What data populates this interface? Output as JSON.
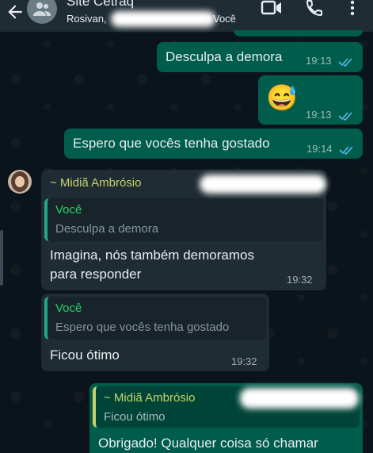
{
  "header": {
    "title": "Site Cetraq",
    "subtitle": "Rosivan,",
    "subtitle_end": "Você"
  },
  "messages": {
    "m1": {
      "text": "Desculpa a demora",
      "time": "19:13"
    },
    "m2": {
      "emoji": "😅",
      "time": "19:13"
    },
    "m3": {
      "text": "Espero que vocês tenha gostado",
      "time": "19:14"
    },
    "m4": {
      "sender": "~ Midiã Ambrósio",
      "quote_author": "Você",
      "quote_text": "Desculpa a demora",
      "line1": "Imagina, nós também demoramos",
      "line2": "para responder",
      "time": "19:32"
    },
    "m5": {
      "quote_author": "Você",
      "quote_text": "Espero que vocês tenha gostado",
      "text": "Ficou ótimo",
      "time": "19:32"
    },
    "m6": {
      "quote_author": "~ Midiã Ambrósio",
      "quote_text": "Ficou ótimo",
      "text": "Obrigado! Qualquer coisa só chamar"
    }
  },
  "colors": {
    "outgoing": "#005c4b",
    "incoming": "#1f2c34",
    "read_ticks": "#53bdeb",
    "accent": "#25d366"
  },
  "icons": [
    "back-arrow-icon",
    "group-avatar-icon",
    "video-call-icon",
    "phone-icon",
    "more-vert-icon",
    "double-check-icon"
  ]
}
